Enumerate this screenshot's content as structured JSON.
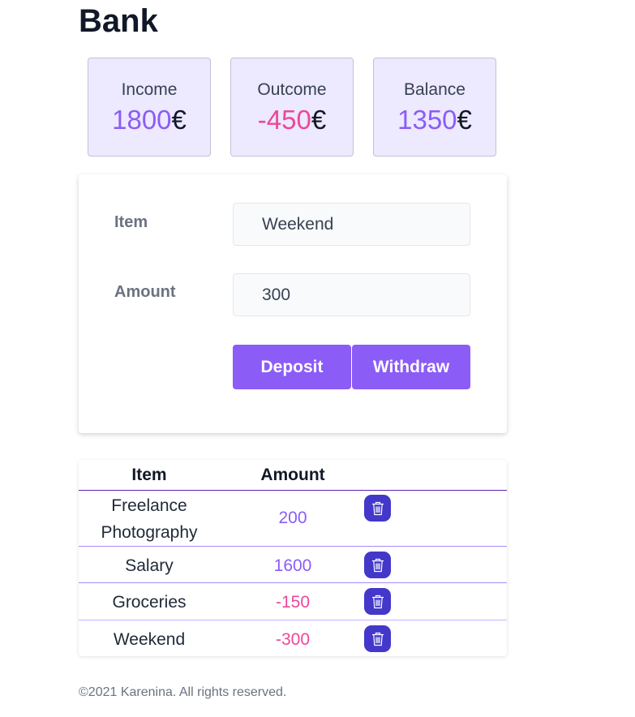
{
  "title": "Bank",
  "summary": {
    "income": {
      "label": "Income",
      "value": "1800",
      "currency": "€"
    },
    "outcome": {
      "label": "Outcome",
      "value": "-450",
      "currency": "€"
    },
    "balance": {
      "label": "Balance",
      "value": "1350",
      "currency": "€"
    }
  },
  "form": {
    "item_label": "Item",
    "item_value": "Weekend",
    "amount_label": "Amount",
    "amount_value": "300",
    "deposit_label": "Deposit",
    "withdraw_label": "Withdraw"
  },
  "table": {
    "headers": {
      "item": "Item",
      "amount": "Amount"
    },
    "rows": [
      {
        "item": "Freelance Photography",
        "amount": "200",
        "type": "income"
      },
      {
        "item": "Salary",
        "amount": "1600",
        "type": "income"
      },
      {
        "item": "Groceries",
        "amount": "-150",
        "type": "expense"
      },
      {
        "item": "Weekend",
        "amount": "-300",
        "type": "expense"
      }
    ]
  },
  "colors": {
    "income": "#8b5cf6",
    "expense": "#ec4899",
    "accent": "#8b5cf6",
    "delete": "#4338ca"
  },
  "icons": {
    "delete": "trash-icon"
  },
  "footer": "©2021 Karenina. All rights reserved."
}
